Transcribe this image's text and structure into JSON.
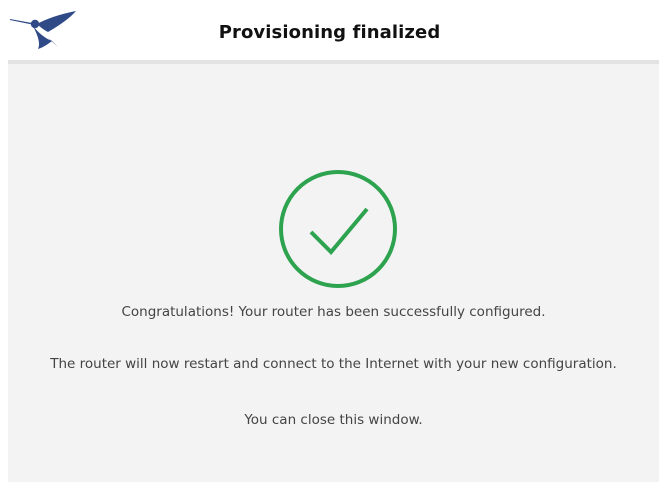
{
  "header": {
    "title": "Provisioning finalized",
    "logo_icon": "hummingbird-logo-icon"
  },
  "status": {
    "icon": "success-check-icon",
    "color": "#2ea34f"
  },
  "messages": [
    "Congratulations! Your router has been successfully configured.",
    "The router will now restart and connect to the Internet with your new configuration.",
    "You can close this window."
  ],
  "colors": {
    "brand": "#2f4a87",
    "success": "#2ea34f",
    "content_bg": "#f3f3f3"
  }
}
